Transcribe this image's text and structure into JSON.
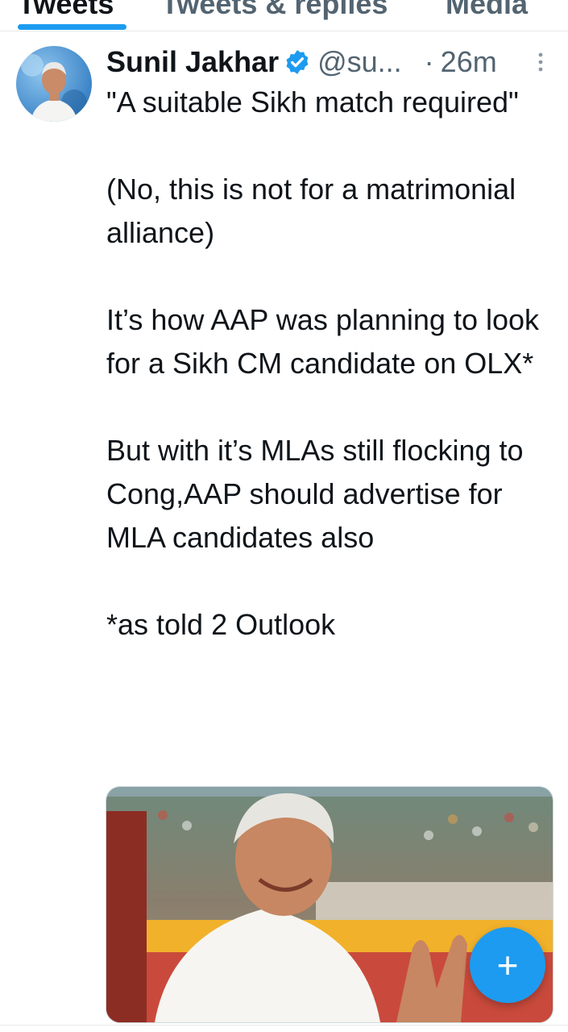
{
  "tabs": [
    {
      "label": "Tweets",
      "active": true
    },
    {
      "label": "Tweets & replies",
      "active": false
    },
    {
      "label": "Media",
      "active": false
    }
  ],
  "tweet": {
    "author_name": "Sunil Jakhar",
    "verified": true,
    "handle": "@su...",
    "separator": "·",
    "timestamp": "26m",
    "paragraphs": [
      "\"A suitable Sikh match required\"",
      "(No, this is not for a matrimonial alliance)",
      "It’s how AAP was planning to look for a Sikh CM candidate on OLX*",
      "But with it’s MLAs still flocking to Cong,AAP should advertise for MLA candidates also",
      "*as told 2 Outlook"
    ],
    "media_icon": "photo"
  },
  "fab": {
    "label": "+",
    "icon": "compose-plus-icon"
  },
  "colors": {
    "accent": "#1d9bf0",
    "text_primary": "#0f1419",
    "text_secondary": "#536471"
  }
}
